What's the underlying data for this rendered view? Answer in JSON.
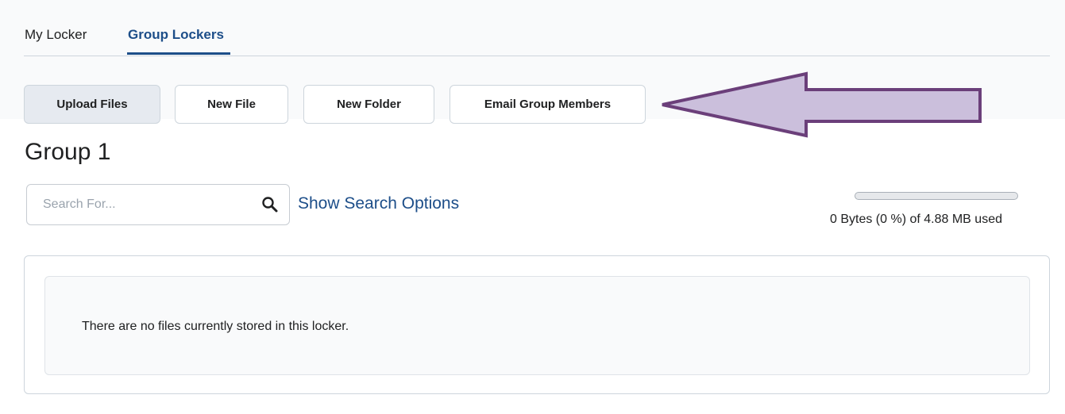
{
  "tabs": [
    {
      "label": "My Locker",
      "active": false
    },
    {
      "label": "Group Lockers",
      "active": true
    }
  ],
  "toolbar": {
    "upload_label": "Upload Files",
    "new_file_label": "New File",
    "new_folder_label": "New Folder",
    "email_label": "Email Group Members"
  },
  "annotation": {
    "icon": "arrow-left-icon",
    "fill": "#cbbfdc",
    "stroke": "#6b3f7a"
  },
  "page_title": "Group 1",
  "search": {
    "placeholder": "Search For...",
    "value": "",
    "icon": "search-icon",
    "options_link": "Show Search Options"
  },
  "storage": {
    "used_fraction": 0,
    "text": "0 Bytes (0 %) of 4.88 MB used"
  },
  "files": {
    "empty_message": "There are no files currently stored in this locker."
  },
  "colors": {
    "accent": "#1d4e89",
    "text": "#202122",
    "border": "#cdd5dc"
  }
}
